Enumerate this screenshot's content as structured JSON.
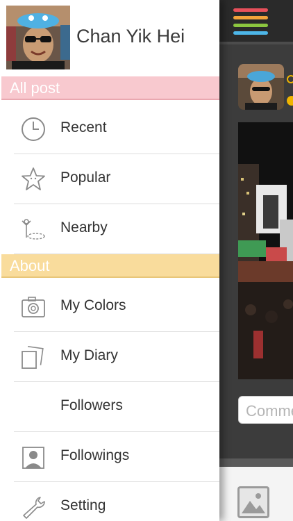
{
  "profile": {
    "name": "Chan Yik Hei"
  },
  "sections": [
    {
      "title": "All post",
      "color": "#f8c9cf",
      "items": [
        {
          "label": "Recent",
          "icon": "clock-icon"
        },
        {
          "label": "Popular",
          "icon": "star-icon"
        },
        {
          "label": "Nearby",
          "icon": "location-pin-icon"
        }
      ]
    },
    {
      "title": "About",
      "color": "#f9dc9c",
      "items": [
        {
          "label": "My Colors",
          "icon": "camera-icon"
        },
        {
          "label": "My Diary",
          "icon": "diary-icon"
        },
        {
          "label": "Followers",
          "icon": ""
        },
        {
          "label": "Followings",
          "icon": "person-icon"
        },
        {
          "label": "Setting",
          "icon": "wrench-icon"
        }
      ]
    }
  ],
  "feed": {
    "comment_placeholder": "Comment",
    "menu_stripe_colors": [
      "#e8505b",
      "#f3a33a",
      "#8cc63f",
      "#4db6e8"
    ]
  }
}
